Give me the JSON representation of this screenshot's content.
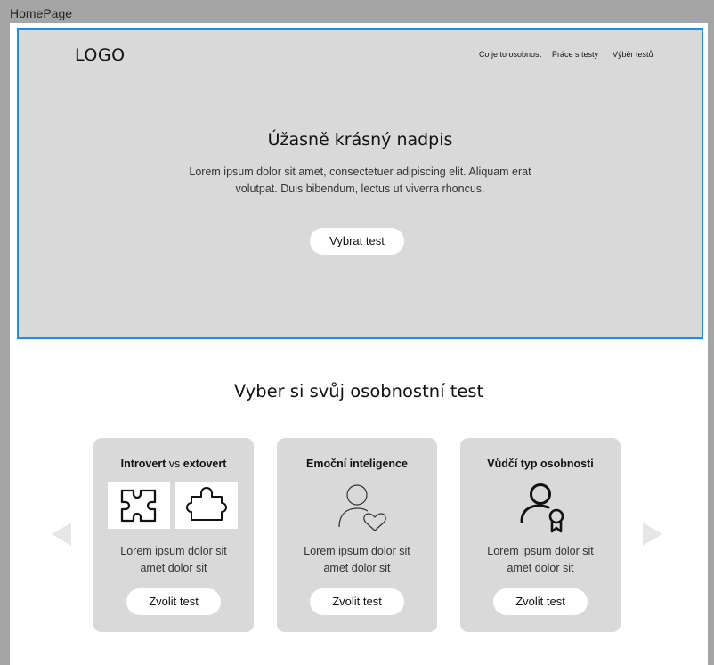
{
  "frame_label": "HomePage",
  "header": {
    "logo": "LOGO",
    "nav": [
      "Co je to osobnost",
      "Práce s testy",
      "Výběr testů"
    ]
  },
  "hero": {
    "title": "Úžasně krásný nadpis",
    "text_line1": "Lorem ipsum dolor sit amet, consectetuer adipiscing elit. Aliquam erat",
    "text_line2": "volutpat. Duis bibendum, lectus ut viverra rhoncus.",
    "button": "Vybrat test"
  },
  "tests_section": {
    "title": "Vyber si svůj osobnostní test",
    "cards": [
      {
        "title_part1": "Introvert",
        "title_mid": " vs ",
        "title_part2": "extovert",
        "icons": [
          "puzzle-inner-icon",
          "puzzle-piece-icon"
        ],
        "text_line1": "Lorem ipsum dolor sit",
        "text_line2": "amet dolor sit",
        "button": "Zvolit test"
      },
      {
        "title": "Emoční inteligence",
        "icon": "person-heart-icon",
        "text_line1": "Lorem ipsum dolor sit",
        "text_line2": "amet dolor sit",
        "button": "Zvolit test"
      },
      {
        "title": "Vůdčí typ osobnosti",
        "icon": "person-badge-icon",
        "text_line1": "Lorem ipsum dolor sit",
        "text_line2": "amet dolor sit",
        "button": "Zvolit test"
      }
    ],
    "carousel_prev_icon": "triangle-left-icon",
    "carousel_next_icon": "triangle-right-icon"
  },
  "colors": {
    "canvas": "#a5a5a5",
    "hero_bg": "#d9d9d9",
    "selection_border": "#1f8fe0",
    "card_bg": "#d9d9d9",
    "button_bg": "#ffffff"
  }
}
